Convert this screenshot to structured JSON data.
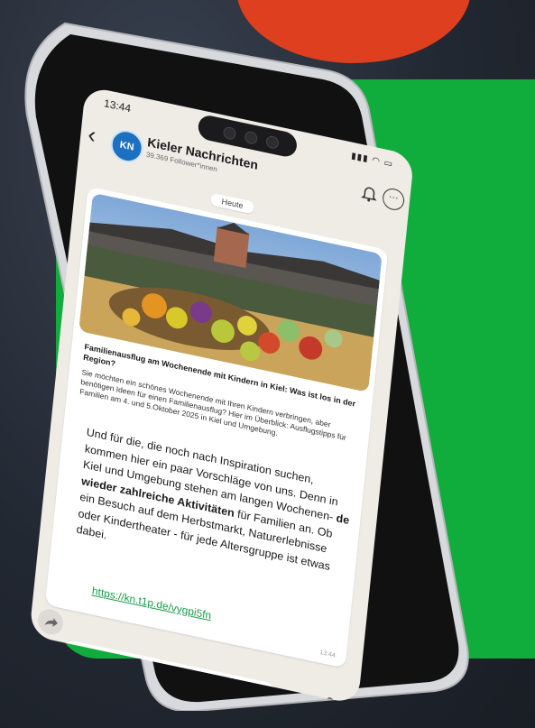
{
  "status_bar": {
    "time": "13:44"
  },
  "channel": {
    "name": "Kieler Nachrichten",
    "followers": "39.369 Follower*innen",
    "logo_text": "KN"
  },
  "date_label": "Heute",
  "post": {
    "headline": "Familienausflug am Wochenende mit Kindern in Kiel: Was ist los in der Region?",
    "teaser": "Sie möchten ein schönes Wochenende mit Ihren Kindern verbringen, aber benötigen Ideen für einen Familienausflug? Hier im Überblick: Ausflugstipps für Familien am 4. und 5.Oktober 2025 in Kiel und Umgebung.",
    "body_part1": "Und für die, die noch nach Inspiration suchen, kommen hier ein paar Vorschläge von uns. Denn in Kiel und Umgebung stehen am langen Wochenen-",
    "body_bold": "de wieder zahlreiche Aktivitäten",
    "body_part2": " für Familien an. Ob ein Besuch auf dem Herbstmarkt, Naturerlebnisse oder Kindertheater - für jede Altersgruppe ist etwas dabei.",
    "link": "https://kn.t1p.de/vygpi5fn",
    "timestamp": "13:44"
  },
  "icons": {
    "back": "back-arrow-icon",
    "bell": "bell-icon",
    "more": "more-icon",
    "share": "share-icon",
    "plus": "plus-icon",
    "sticker": "sticker-icon",
    "camera": "camera-icon",
    "mic": "microphone-icon"
  },
  "colors": {
    "background_green": "#10ad3c",
    "accent_orange": "#dd3f1f",
    "logo_blue": "#1d6fc0",
    "link_green": "#1a9c4a"
  }
}
